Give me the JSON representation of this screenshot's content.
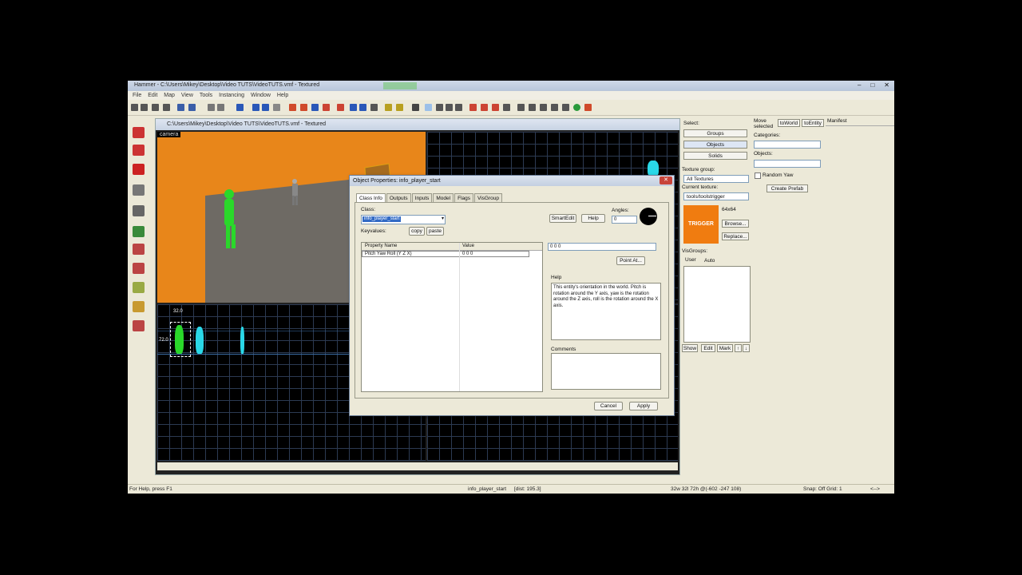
{
  "app": {
    "title": "Hammer - C:\\Users\\Mikey\\Desktop\\Video TUTS\\VideoTUTS.vmf - Textured",
    "window_buttons": [
      "–",
      "□",
      "✕"
    ]
  },
  "menu": [
    "File",
    "Edit",
    "Map",
    "View",
    "Tools",
    "Instancing",
    "Window",
    "Help"
  ],
  "doc": {
    "title": "C:\\Users\\Mikey\\Desktop\\Video TUTS\\VideoTUTS.vmf - Textured",
    "view3d_label": "camera",
    "ruler_top": "32.0",
    "ruler_left": "72.0"
  },
  "right_panel": {
    "select_label": "Select:",
    "groups": "Groups",
    "objects": "Objects",
    "solids": "Solids",
    "texture_group_label": "Texture group:",
    "texture_group_value": "All Textures",
    "current_texture_label": "Current texture:",
    "current_texture_value": "tools/toolstrigger",
    "texture_preview": "TRIGGER",
    "texture_size": "64x64",
    "browse": "Browse...",
    "replace": "Replace...",
    "visgroups_label": "VisGroups:",
    "tab_user": "User",
    "tab_auto": "Auto",
    "show": "Show",
    "edit": "Edit",
    "mark": "Mark",
    "move_selected": "Move selected",
    "to_world": "toWorld",
    "to_entity": "toEntity",
    "manifest": "Manifest",
    "categories_label": "Categories:",
    "objects_label": "Objects:",
    "random_yaw": "Random Yaw",
    "create_prefab": "Create Prefab"
  },
  "dialog": {
    "title": "Object Properties: info_player_start",
    "close": "✕",
    "tabs": [
      "Class Info",
      "Outputs",
      "Inputs",
      "Model",
      "Flags",
      "VisGroup"
    ],
    "class_label": "Class:",
    "class_value": "info_player_start",
    "smartedit": "SmartEdit",
    "help": "Help",
    "angles_label": "Angles:",
    "angles_value": "0",
    "keyvalues_label": "Keyvalues:",
    "copy": "copy",
    "paste": "paste",
    "col_property": "Property Name",
    "col_value": "Value",
    "rows": [
      {
        "name": "Pitch Yaw Roll (Y Z X)",
        "value": "0 0 0"
      }
    ],
    "value_field": "0 0 0",
    "point_at": "Point At...",
    "help_label": "Help",
    "help_text": "This entity's orientation in the world. Pitch is rotation around the Y axis, yaw is the rotation around the Z axis, roll is the rotation around the X axis.",
    "comments_label": "Comments",
    "cancel": "Cancel",
    "apply": "Apply"
  },
  "status": {
    "left": "For Help, press F1",
    "center": "info_player_start",
    "dist": "[dist: 195.3]",
    "coords": "32w 32l 72h @(-602 -247 108)",
    "snap": "Snap: Off Grid: 1",
    "arrows": "<-->"
  }
}
